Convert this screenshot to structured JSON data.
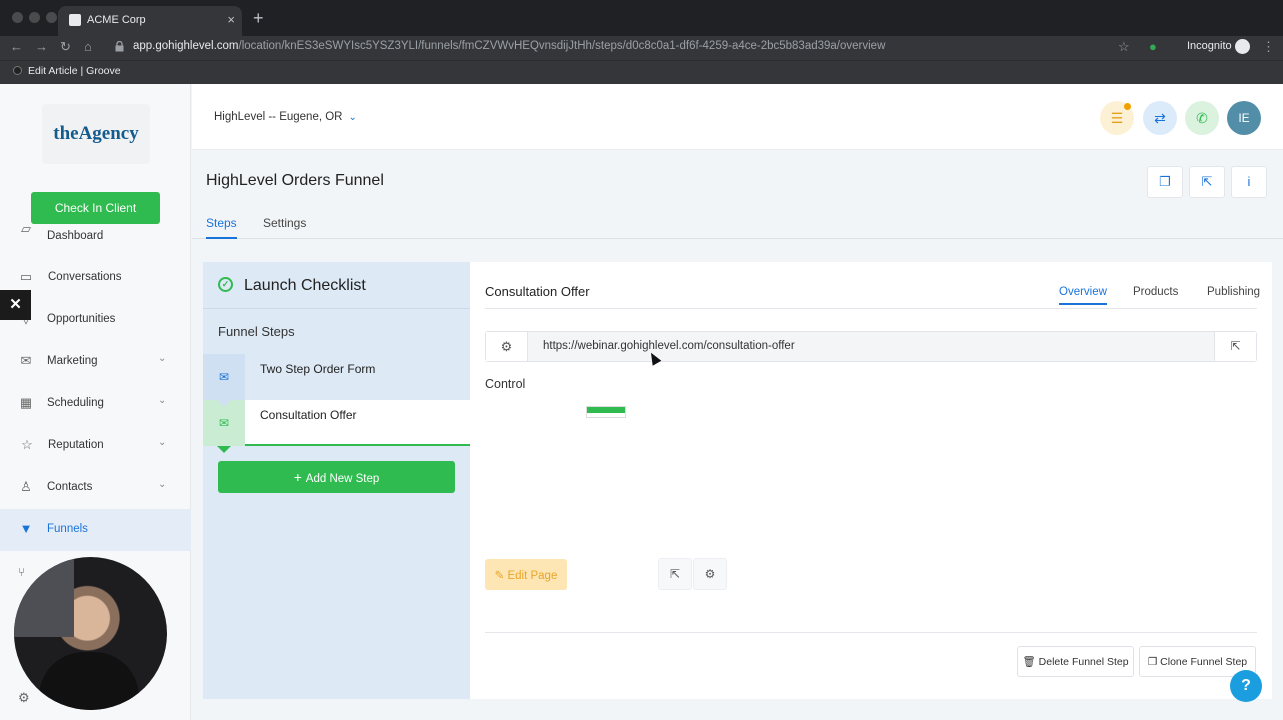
{
  "browser": {
    "tab_title": "ACME Corp",
    "tab_close": "×",
    "new_tab": "+",
    "url_host": "app.gohighlevel.com",
    "url_path": "/location/knES3eSWYIsc5YSZ3YLI/funnels/fmCZVWvHEQvnsdijJtHh/steps/d0c8c0a1-df6f-4259-a4ce-2bc5b83ad39a/overview",
    "profile_label": "Incognito",
    "bookmark_label": "Edit Article | Groove"
  },
  "sidebar": {
    "logo_text": "theAgency",
    "check_in_label": "Check In Client",
    "items": [
      {
        "label": "Dashboard",
        "icon": "dashboard-icon"
      },
      {
        "label": "Conversations",
        "icon": "chat-icon"
      },
      {
        "label": "Opportunities",
        "icon": "funnel-icon"
      },
      {
        "label": "Marketing",
        "icon": "mail-icon",
        "chevron": "⌄"
      },
      {
        "label": "Scheduling",
        "icon": "calendar-icon",
        "chevron": "⌄"
      },
      {
        "label": "Reputation",
        "icon": "star-icon",
        "chevron": "⌄"
      },
      {
        "label": "Contacts",
        "icon": "user-icon",
        "chevron": "⌄"
      },
      {
        "label": "Funnels",
        "icon": "filter-icon"
      }
    ],
    "close_label": "✕"
  },
  "header": {
    "location_label": "HighLevel -- Eugene, OR",
    "avatar_initials": "IE"
  },
  "page": {
    "title": "HighLevel Orders Funnel",
    "tabs": [
      "Steps",
      "Settings"
    ]
  },
  "funnel": {
    "launch_checklist": "Launch Checklist",
    "steps_heading": "Funnel Steps",
    "steps": [
      "Two Step Order Form",
      "Consultation Offer"
    ],
    "add_step_label": "Add New Step"
  },
  "detail": {
    "title": "Consultation Offer",
    "tabs": [
      "Overview",
      "Products",
      "Publishing"
    ],
    "page_url": "https://webinar.gohighlevel.com/consultation-offer",
    "control_label": "Control",
    "edit_page_label": "Edit Page",
    "delete_step_label": "Delete Funnel Step",
    "clone_step_label": "Clone Funnel Step"
  },
  "help_label": "?",
  "colors": {
    "accent": "#1a73d9",
    "success": "#2fbb4f",
    "warning": "#e9a527"
  }
}
